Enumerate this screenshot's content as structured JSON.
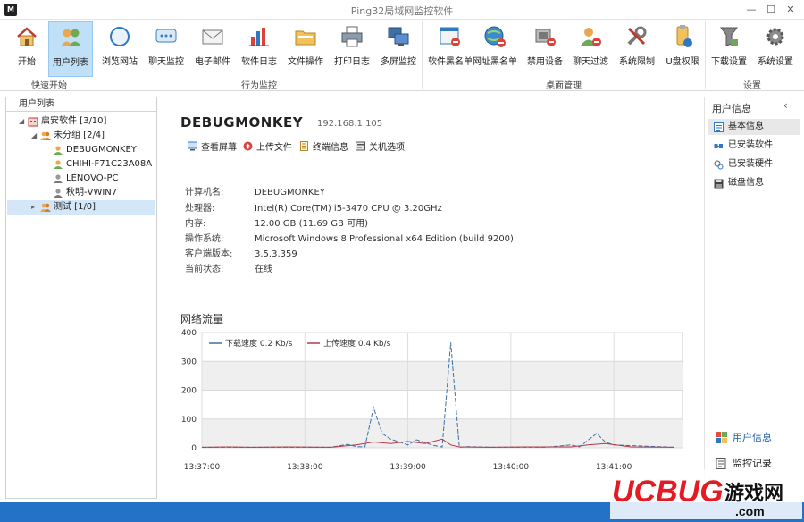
{
  "window": {
    "title": "Ping32局域网监控软件",
    "minimize": "—",
    "maximize": "☐",
    "close": "✕"
  },
  "toolbar": {
    "buttons": [
      {
        "label": "开始",
        "icon": "home-icon"
      },
      {
        "label": "用户列表",
        "icon": "users-icon"
      },
      {
        "label": "浏览网站",
        "icon": "browser-icon"
      },
      {
        "label": "聊天监控",
        "icon": "chat-icon"
      },
      {
        "label": "电子邮件",
        "icon": "mail-icon"
      },
      {
        "label": "软件日志",
        "icon": "bar-chart-icon"
      },
      {
        "label": "文件操作",
        "icon": "folder-icon"
      },
      {
        "label": "打印日志",
        "icon": "printer-icon"
      },
      {
        "label": "多屏监控",
        "icon": "monitors-icon"
      },
      {
        "label": "软件黑名单",
        "icon": "app-block-icon"
      },
      {
        "label": "网址黑名单",
        "icon": "globe-block-icon"
      },
      {
        "label": "禁用设备",
        "icon": "device-block-icon"
      },
      {
        "label": "聊天过滤",
        "icon": "user-block-icon"
      },
      {
        "label": "系统限制",
        "icon": "tools-icon"
      },
      {
        "label": "U盘权限",
        "icon": "usb-icon"
      },
      {
        "label": "下载设置",
        "icon": "download-icon"
      },
      {
        "label": "系统设置",
        "icon": "gear-icon"
      }
    ],
    "groups": [
      "快速开始",
      "行为监控",
      "桌面管理",
      "设置"
    ]
  },
  "tree": {
    "header": "用户列表",
    "nodes": [
      {
        "label": "启安软件  [3/10]"
      },
      {
        "label": "未分组  [2/4]"
      },
      {
        "label": "DEBUGMONKEY"
      },
      {
        "label": "CHIHI-F71C23A08A"
      },
      {
        "label": "LENOVO-PC"
      },
      {
        "label": "秋明-VWIN7"
      },
      {
        "label": "测试  [1/0]"
      }
    ]
  },
  "main": {
    "host_name": "DEBUGMONKEY",
    "host_ip": "192.168.1.105",
    "actions": [
      "查看屏幕",
      "上传文件",
      "终端信息",
      "关机选项"
    ],
    "info": [
      {
        "k": "计算机名:",
        "v": "DEBUGMONKEY"
      },
      {
        "k": "处理器:",
        "v": "Intel(R) Core(TM) i5-3470 CPU @ 3.20GHz"
      },
      {
        "k": "内存:",
        "v": "12.00 GB (11.69 GB 可用)"
      },
      {
        "k": "操作系统:",
        "v": "Microsoft Windows 8 Professional x64 Edition (build 9200)"
      },
      {
        "k": "客户端版本:",
        "v": "3.5.3.359"
      },
      {
        "k": "当前状态:",
        "v": "在线"
      }
    ],
    "net_title": "网络流量"
  },
  "chart_data": {
    "type": "line",
    "x": [
      "13:37:00",
      "13:38:00",
      "13:39:00",
      "13:40:00",
      "13:41:00"
    ],
    "ylim": [
      0,
      400
    ],
    "yticks": [
      0,
      100,
      200,
      300,
      400
    ],
    "legend_placement": "top-left",
    "series": [
      {
        "name": "下载速度 0.2 Kb/s",
        "color": "#3c6fa8",
        "points": [
          [
            0,
            2
          ],
          [
            8,
            2
          ],
          [
            15,
            2
          ],
          [
            17,
            12
          ],
          [
            18,
            4
          ],
          [
            19,
            3
          ],
          [
            20,
            140
          ],
          [
            21,
            50
          ],
          [
            22,
            30
          ],
          [
            23,
            20
          ],
          [
            24,
            10
          ],
          [
            25,
            28
          ],
          [
            26,
            18
          ],
          [
            27,
            8
          ],
          [
            28,
            3
          ],
          [
            29,
            365
          ],
          [
            30,
            2
          ],
          [
            31,
            4
          ],
          [
            34,
            2
          ],
          [
            40,
            2
          ],
          [
            43,
            10
          ],
          [
            44,
            3
          ],
          [
            46,
            50
          ],
          [
            47,
            20
          ],
          [
            48,
            10
          ],
          [
            55,
            2
          ]
        ]
      },
      {
        "name": "上传速度 0.4 Kb/s",
        "color": "#b23a48",
        "points": [
          [
            0,
            2
          ],
          [
            3,
            3
          ],
          [
            6,
            2
          ],
          [
            10,
            3
          ],
          [
            15,
            2
          ],
          [
            18,
            10
          ],
          [
            20,
            20
          ],
          [
            22,
            15
          ],
          [
            24,
            22
          ],
          [
            26,
            15
          ],
          [
            28,
            30
          ],
          [
            29,
            10
          ],
          [
            30,
            3
          ],
          [
            33,
            2
          ],
          [
            38,
            3
          ],
          [
            43,
            3
          ],
          [
            45,
            10
          ],
          [
            47,
            15
          ],
          [
            50,
            3
          ],
          [
            55,
            2
          ]
        ]
      }
    ]
  },
  "right_panel": {
    "title": "用户信息",
    "collapse": "‹",
    "items": [
      "基本信息",
      "已安装软件",
      "已安装硬件",
      "磁盘信息"
    ],
    "bottom": [
      "用户信息",
      "监控记录"
    ]
  },
  "watermark": {
    "brand": "UCBUG",
    "suffix": "游戏网",
    "url": ".com"
  }
}
